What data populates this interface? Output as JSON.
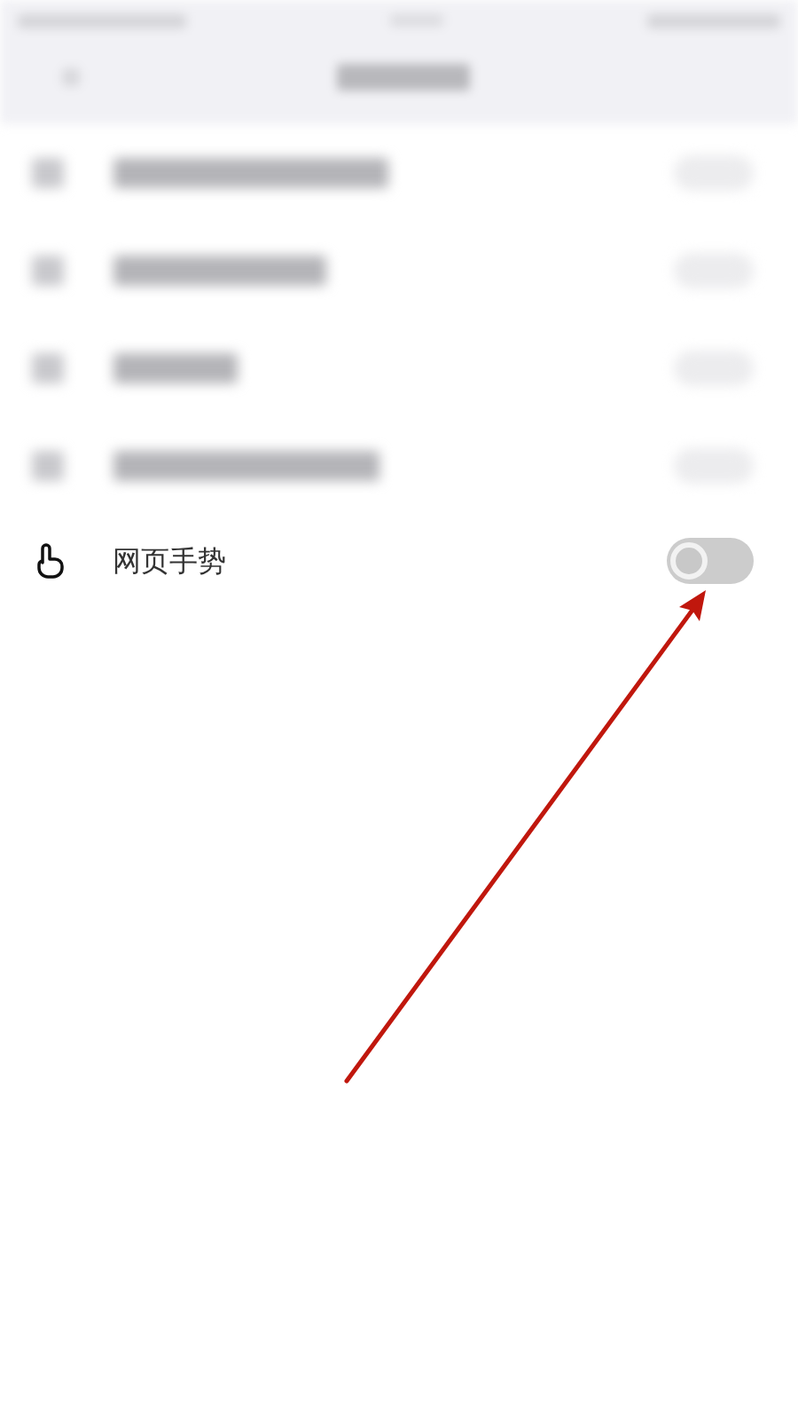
{
  "setting": {
    "label": "网页手势",
    "on": false
  }
}
